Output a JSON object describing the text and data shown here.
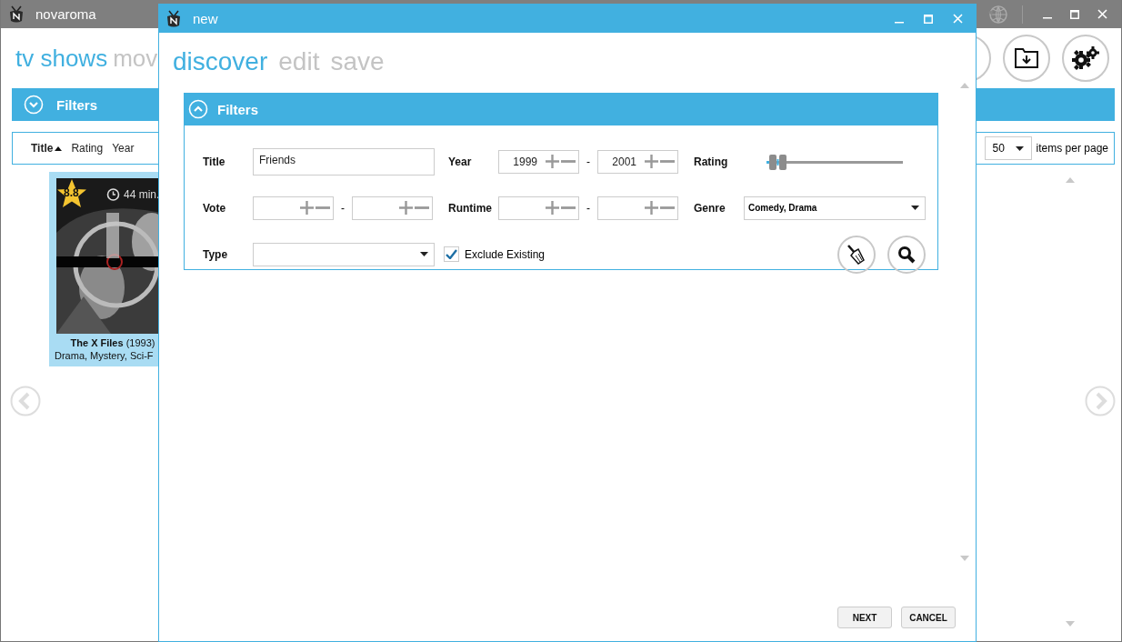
{
  "main_window": {
    "title": "novaroma",
    "nav": [
      {
        "label": "tv shows",
        "selected": true
      },
      {
        "label": "mov",
        "selected": false
      }
    ],
    "filters": {
      "label": "Filters",
      "expanded": false
    },
    "sort_options": [
      {
        "label": "Title",
        "selected": true
      },
      {
        "label": "Rating",
        "selected": false
      },
      {
        "label": "Year",
        "selected": false
      }
    ],
    "page_size": {
      "value": "50",
      "label": "items per page"
    },
    "shows": [
      {
        "kind": "picture",
        "rating": "8.8",
        "runtime": "44 min.",
        "title": "The X Files",
        "year": "(1993)",
        "genres": "Drama, Mystery, Sci-F",
        "selected": true
      }
    ]
  },
  "dialog": {
    "title": "new",
    "nav": [
      {
        "label": "discover",
        "selected": true
      },
      {
        "label": "edit",
        "selected": false
      },
      {
        "label": "save",
        "selected": false
      }
    ],
    "filters": {
      "label": "Filters",
      "expanded": true,
      "title": {
        "label": "Title",
        "value": "Friends"
      },
      "year": {
        "label": "Year",
        "from": "1999",
        "separator": "-",
        "to": "2001"
      },
      "rating": {
        "label": "Rating",
        "level": 0.03
      },
      "vote": {
        "label": "Vote",
        "separator": "-"
      },
      "runtime": {
        "label": "Runtime",
        "separator": "-"
      },
      "genre": {
        "label": "Genre",
        "value": "Comedy, Drama"
      },
      "type": {
        "label": "Type"
      },
      "exclude_existing": {
        "label": "Exclude Existing",
        "checked": true
      }
    },
    "buttons": [
      "NEXT",
      "CANCEL"
    ]
  }
}
